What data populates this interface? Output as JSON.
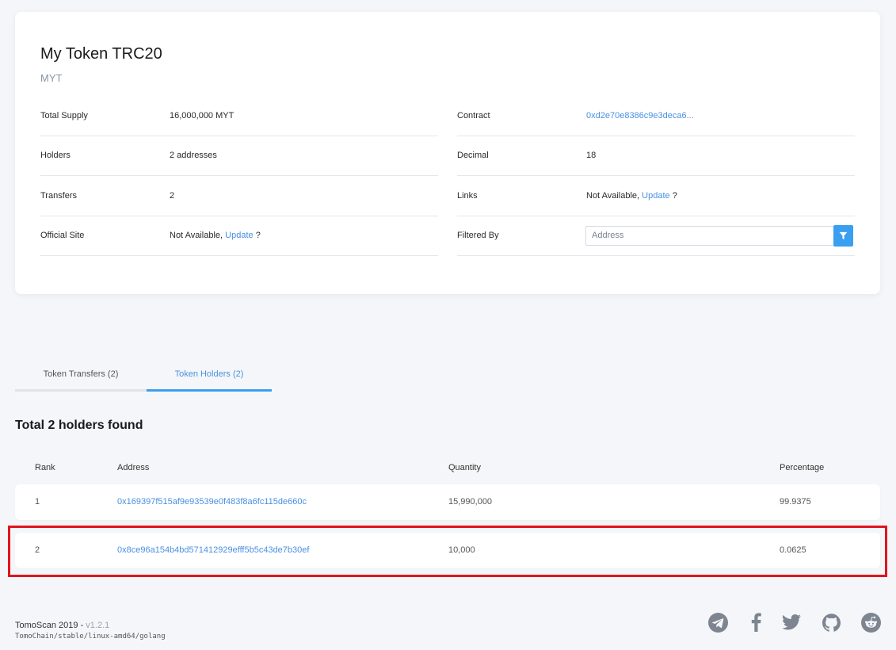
{
  "token": {
    "name": "My Token TRC20",
    "symbol": "MYT"
  },
  "info_left": [
    {
      "label": "Total Supply",
      "value": "16,000,000 MYT"
    },
    {
      "label": "Holders",
      "value": "2 addresses"
    },
    {
      "label": "Transfers",
      "value": "2"
    },
    {
      "label": "Official Site",
      "value": "Not Available,",
      "link": "Update",
      "suffix": "?"
    }
  ],
  "info_right": [
    {
      "label": "Contract",
      "value": "0xd2e70e8386c9e3deca6..."
    },
    {
      "label": "Decimal",
      "value": "18"
    },
    {
      "label": "Links",
      "value": "Not Available,",
      "link": "Update",
      "suffix": "?"
    },
    {
      "label": "Filtered By",
      "placeholder": "Address"
    }
  ],
  "tabs": [
    {
      "label": "Token Transfers (2)"
    },
    {
      "label": "Token Holders (2)"
    }
  ],
  "holders": {
    "title": "Total 2 holders found",
    "columns": [
      "Rank",
      "Address",
      "Quantity",
      "Percentage"
    ],
    "rows": [
      {
        "rank": "1",
        "address": "0x169397f515af9e93539e0f483f8a6fc115de660c",
        "quantity": "15,990,000",
        "percentage": "99.9375"
      },
      {
        "rank": "2",
        "address": "0x8ce96a154b4bd571412929efff5b5c43de7b30ef",
        "quantity": "10,000",
        "percentage": "0.0625"
      }
    ]
  },
  "footer": {
    "brand": "TomoScan 2019 -",
    "version": "v1.2.1",
    "build": "TomoChain/stable/linux-amd64/golang"
  },
  "social_icons": [
    "telegram-icon",
    "facebook-icon",
    "twitter-icon",
    "github-icon",
    "reddit-icon"
  ],
  "colors": {
    "link": "#4a90e2",
    "accent": "#3a9ff0",
    "highlight": "#e0161c",
    "icon": "#7d8591"
  }
}
